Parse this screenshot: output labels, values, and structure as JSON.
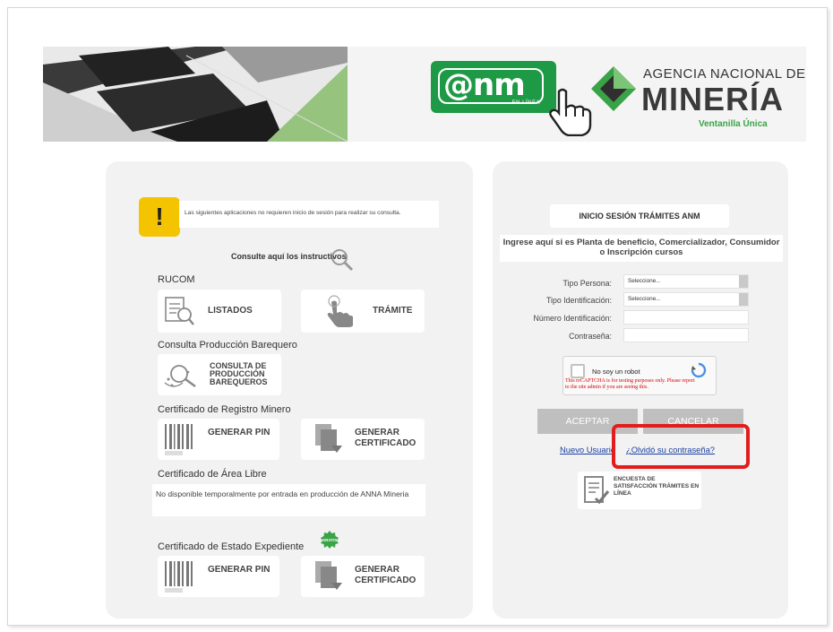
{
  "header": {
    "anm_logo_text": "@nm",
    "anm_logo_sub": "EN LÍNEA",
    "agency_line1": "AGENCIA NACIONAL DE",
    "agency_line2": "MINERÍA",
    "agency_line3": "Ventanilla Única"
  },
  "left": {
    "notice": "Las siguientes aplicaciones no requieren inicio de sesión para realizar su consulta.",
    "instructions_link": "Consulte aquí los instructivos",
    "rucom": {
      "title": "RUCOM",
      "listados": "LISTADOS",
      "tramite": "TRÁMITE"
    },
    "barequero": {
      "title": "Consulta Producción Barequero",
      "card_label": "CONSULTA DE PRODUCCIÓN BAREQUEROS"
    },
    "registro": {
      "title": "Certificado de Registro Minero",
      "pin": "GENERAR PIN",
      "certificado": "GENERAR CERTIFICADO"
    },
    "area_libre": {
      "title": "Certificado de Área Libre",
      "note": "No disponible temporalmente por entrada en producción de ANNA Mineria"
    },
    "expediente": {
      "title": "Certificado de Estado Expediente",
      "badge": "GRATIS",
      "pin": "GENERAR PIN",
      "certificado": "GENERAR CERTIFICADO"
    }
  },
  "right": {
    "title": "INICIO SESIÓN TRÁMITES ANM",
    "description": "Ingrese aquí si es Planta de beneficio, Comercializador, Consumidor o Inscripción cursos",
    "fields": {
      "tipo_persona_label": "Tipo Persona:",
      "tipo_persona_value": "Seleccione...",
      "tipo_ident_label": "Tipo Identificación:",
      "tipo_ident_value": "Seleccione...",
      "numero_label": "Número Identificación:",
      "password_label": "Contraseña:"
    },
    "captcha": {
      "label": "No soy un robot",
      "warning": "This reCAPTCHA is for testing purposes only. Please report to the site admin if you are seeing this."
    },
    "accept": "ACEPTAR",
    "cancel": "CANCELAR",
    "new_user": "Nuevo Usuario",
    "forgot": "¿Olvidó su contraseña?",
    "survey": "ENCUESTA DE SATISFACCIÓN TRÁMITES EN LÍNEA"
  },
  "colors": {
    "anm_green": "#1e9a46",
    "notice_yellow": "#f5c400",
    "link_blue": "#1a3fa0",
    "highlight_red": "#e31c1c"
  }
}
